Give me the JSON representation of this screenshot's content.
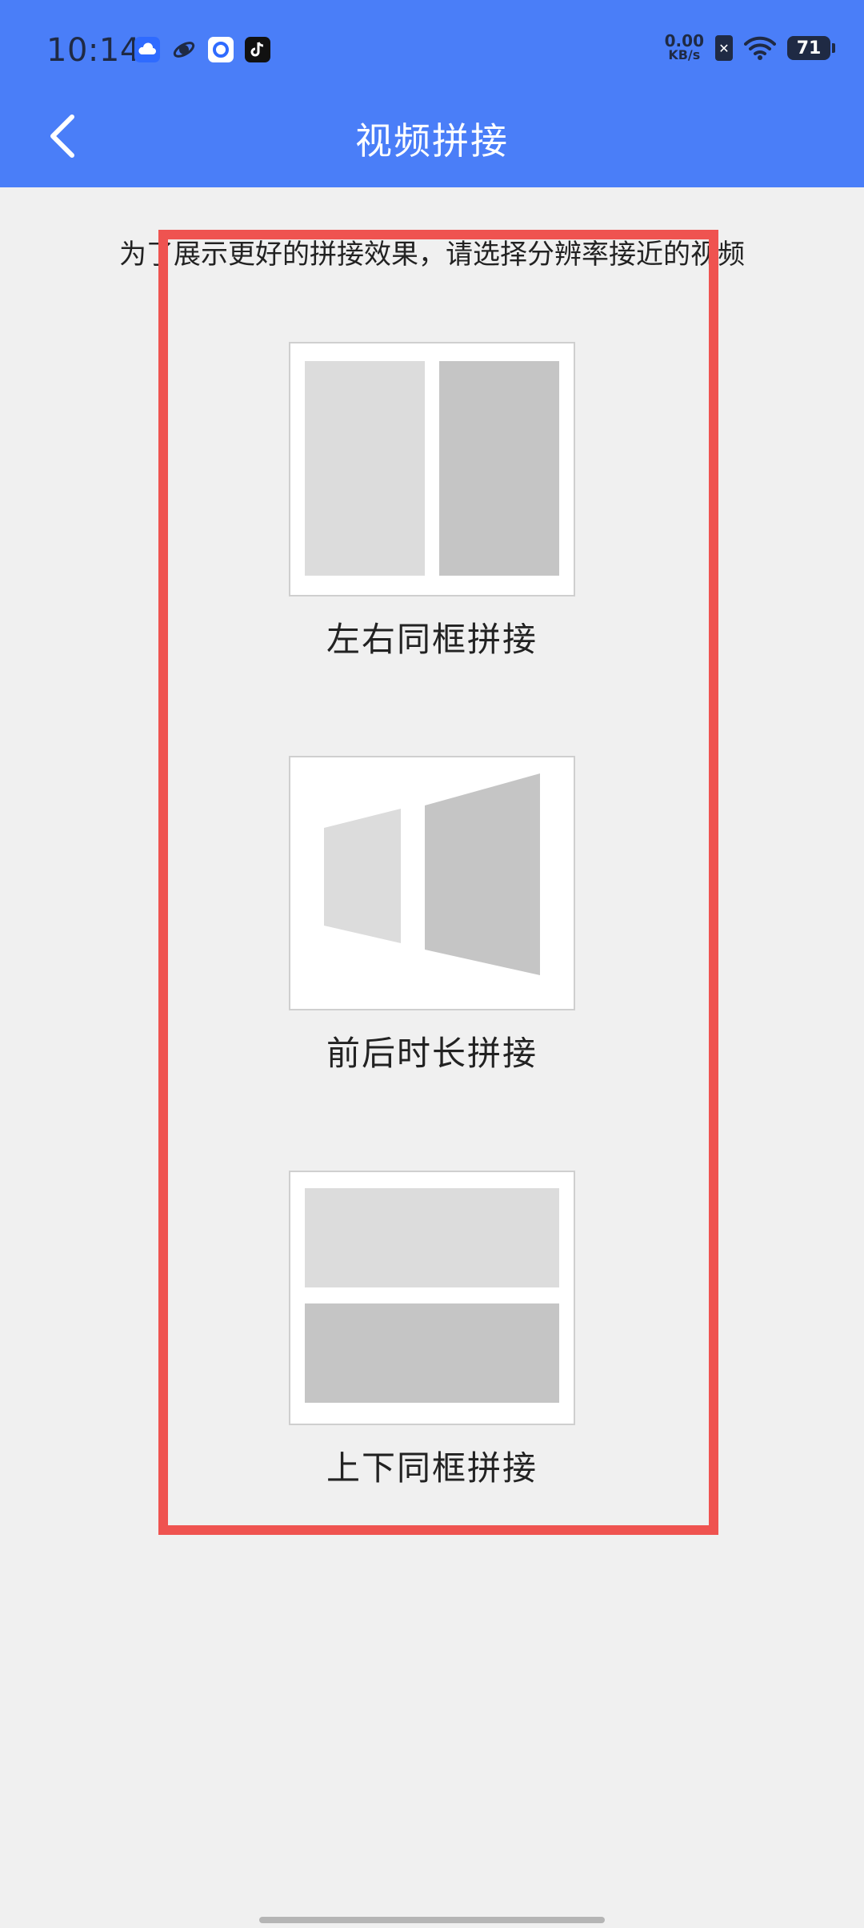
{
  "status_bar": {
    "time": "10:14",
    "net_speed_value": "0.00",
    "net_speed_unit": "KB/s",
    "battery_level": "71",
    "app_icons": [
      "cloud-app-icon",
      "planet-app-icon",
      "circle-app-icon",
      "tiktok-icon"
    ],
    "sim_icon_glyph": "✕"
  },
  "header": {
    "title": "视频拼接",
    "back_icon": "chevron-left-icon",
    "color": "#4a7ef8"
  },
  "hint": "为了展示更好的拼接效果，请选择分辨率接近的视频",
  "options": [
    {
      "label": "左右同框拼接",
      "icon": "side-by-side-layout-icon"
    },
    {
      "label": "前后时长拼接",
      "icon": "sequential-layout-icon"
    },
    {
      "label": "上下同框拼接",
      "icon": "top-bottom-layout-icon"
    }
  ],
  "highlight_color": "#ef5350"
}
